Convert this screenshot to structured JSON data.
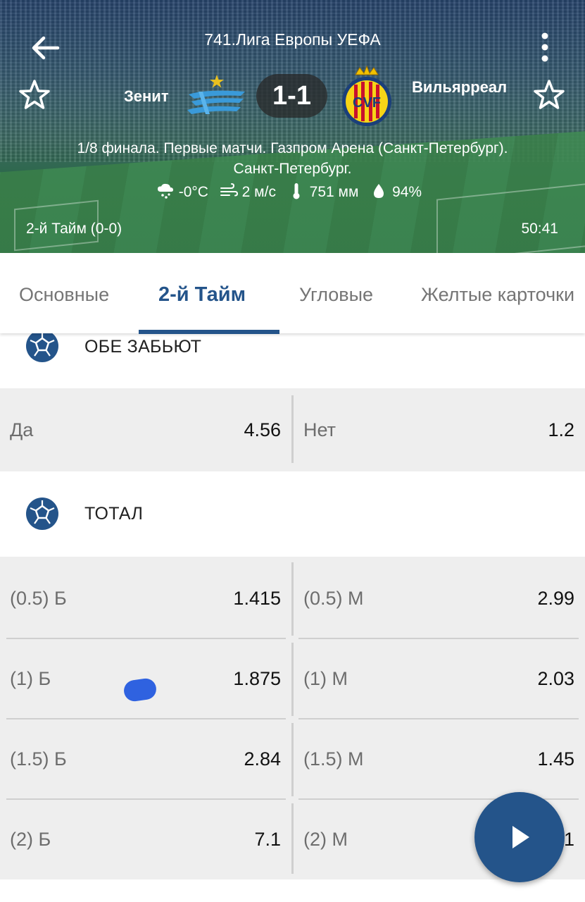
{
  "header": {
    "league": "741.Лига Европы УЕФА",
    "team1": "Зенит",
    "team2": "Вильярреал",
    "score": "1-1",
    "stage_line1": "1/8 финала. Первые матчи. Газпром Арена (Санкт-Петербург).",
    "stage_line2": "Санкт-Петербург.",
    "weather": {
      "temperature": "-0°C",
      "wind": "2 м/с",
      "pressure": "751 мм",
      "humidity": "94%"
    },
    "half_status": "2-й  Тайм (0-0)",
    "match_time": "50:41",
    "icons": [
      "back-arrow-icon",
      "more-vert-icon",
      "star-outline-icon",
      "snow-cloud-icon",
      "wind-icon",
      "thermometer-icon",
      "water-drop-icon"
    ]
  },
  "tabs": [
    {
      "label": "Основные",
      "active": false
    },
    {
      "label": "2-й  Тайм",
      "active": true
    },
    {
      "label": "Угловые",
      "active": false
    },
    {
      "label": "Желтые карточки",
      "active": false
    }
  ],
  "both_score": {
    "title": "ОБЕ ЗАБЬЮТ",
    "yes_label": "Да",
    "yes_value": "4.56",
    "no_label": "Нет",
    "no_value": "1.2"
  },
  "total": {
    "title": "ТОТАЛ",
    "rows": [
      {
        "over_label": "(0.5) Б",
        "over_value": "1.415",
        "under_label": "(0.5) М",
        "under_value": "2.99"
      },
      {
        "over_label": "(1) Б",
        "over_value": "1.875",
        "under_label": "(1) М",
        "under_value": "2.03"
      },
      {
        "over_label": "(1.5) Б",
        "over_value": "2.84",
        "under_label": "(1.5) М",
        "under_value": "1.45"
      },
      {
        "over_label": "(2) Б",
        "over_value": "7.1",
        "under_label": "(2) М",
        "under_value": "1"
      }
    ]
  },
  "colors": {
    "accent": "#24548a",
    "odds_background": "#eeeeee",
    "inactive_tab": "#757575"
  }
}
